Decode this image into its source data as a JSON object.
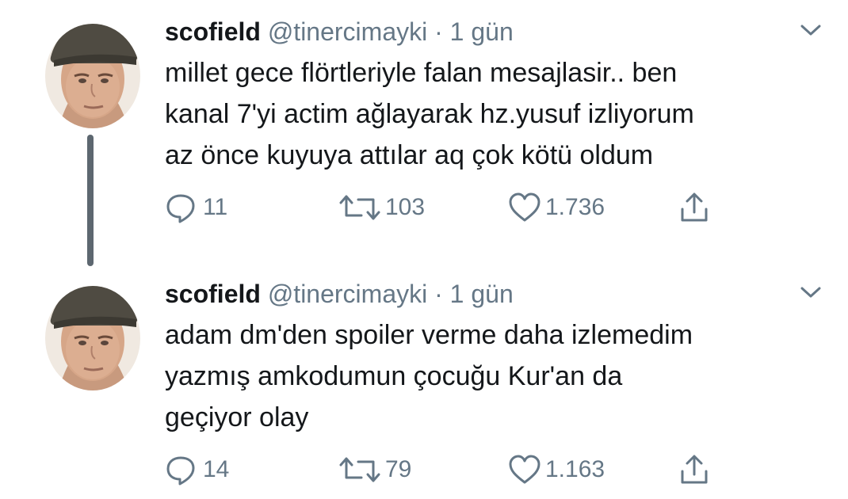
{
  "tweets": [
    {
      "name": "scofield",
      "handle": "@tinercimayki",
      "separator": "·",
      "time": "1 gün",
      "lines": [
        "millet gece flörtleriyle falan mesajlasir.. ben",
        "kanal 7'yi actim ağlayarak hz.yusuf izliyorum",
        "az önce kuyuya attılar aq çok kötü oldum"
      ],
      "replies": "11",
      "retweets": "103",
      "likes": "1.736"
    },
    {
      "name": "scofield",
      "handle": "@tinercimayki",
      "separator": "·",
      "time": "1 gün",
      "lines": [
        "adam dm'den spoiler verme daha izlemedim",
        "yazmış amkodumun çocuğu Kur'an da",
        "geçiyor olay"
      ],
      "replies": "14",
      "retweets": "79",
      "likes": "1.163"
    }
  ],
  "colors": {
    "text": "#14171a",
    "secondary": "#657786",
    "thread_line": "#5d6770"
  },
  "icons": {
    "reply": "speech-bubble",
    "retweet": "retweet-arrows",
    "like": "heart-outline",
    "share": "share-upload",
    "menu": "chevron-down"
  }
}
